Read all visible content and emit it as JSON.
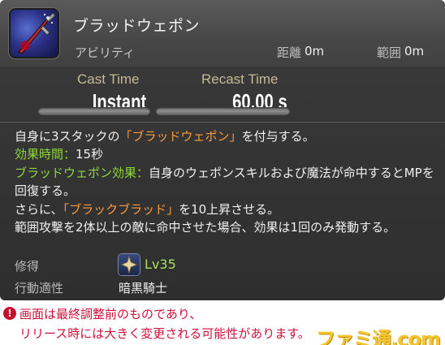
{
  "skill": {
    "name": "ブラッドウェポン",
    "type": "アビリティ",
    "range_label": "距離",
    "range_value": "0m",
    "radius_label": "範囲",
    "radius_value": "0m",
    "icon": "blood-weapon-sword-icon"
  },
  "timing": {
    "cast_label": "Cast Time",
    "cast_value": "Instant",
    "recast_label": "Recast Time",
    "recast_value": "60.00 s"
  },
  "description": {
    "line1_prefix": "自身に3スタックの",
    "line1_highlight": "「ブラッドウェポン」",
    "line1_suffix": "を付与する。",
    "duration_label": "効果時間：",
    "duration_value": "15秒",
    "effect_label": "ブラッドウェポン効果：",
    "effect_text": "自身のウェポンスキルおよび魔法が命中するとMPを回復する。",
    "line4_prefix": "さらに、",
    "line4_highlight": "「ブラックブラッド」",
    "line4_suffix": "を10上昇させる。",
    "line5": "範囲攻撃を2体以上の敵に命中させた場合、効果は1回のみ発動する。"
  },
  "acquire": {
    "label": "修得",
    "level": "Lv35",
    "icon": "dark-knight-job-icon"
  },
  "job": {
    "label": "行動適性",
    "value": "暗黒騎士"
  },
  "notice": {
    "icon": "!",
    "line1": "画面は最終調整前のものであり、",
    "line2": "リリース時には大きく変更される可能性があります。",
    "logo": "ファミ通.com"
  },
  "colors": {
    "highlight_orange": "#ff9a3c",
    "highlight_green": "#8ed83a",
    "level_green": "#a6e05c",
    "notice_red": "#d0103a"
  }
}
